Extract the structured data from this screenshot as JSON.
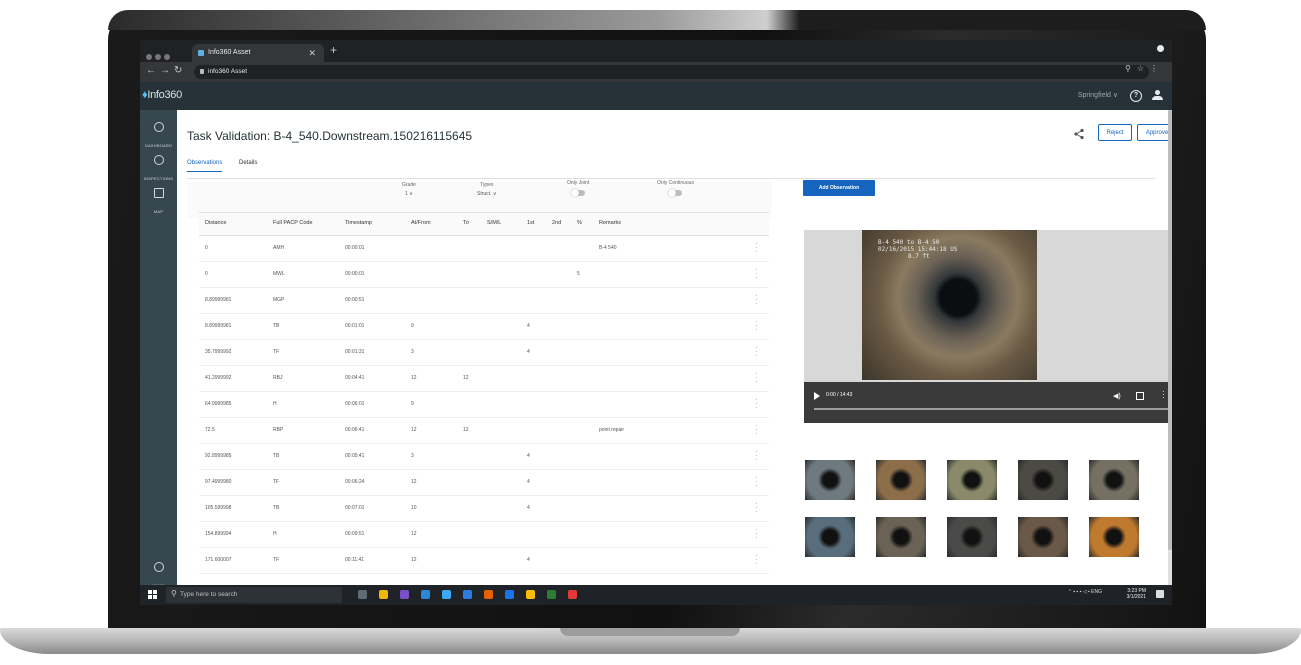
{
  "browser": {
    "tab_title": "Info360 Asset",
    "url": "info360 Asset"
  },
  "app": {
    "logo_text": "Info360",
    "user_location": "Springfield",
    "help_glyph": "?"
  },
  "sidebar": {
    "items": [
      {
        "label": "DASHBOARD",
        "icon": "dashboard-icon"
      },
      {
        "label": "INSPECTIONS",
        "icon": "inspections-icon"
      },
      {
        "label": "MAP",
        "icon": "map-icon"
      },
      {
        "label": "ADMIN",
        "icon": "settings-icon"
      }
    ]
  },
  "page": {
    "title": "Task Validation: B-4_540.Downstream.150216115645",
    "reject_label": "Reject",
    "approve_label": "Approve",
    "tabs": [
      "Observations",
      "Details"
    ]
  },
  "filters": {
    "grade_label": "Grade",
    "grade_value": "1 ∨",
    "types_label": "Types",
    "types_value": "Struct. ∨",
    "only_joint_label": "Only Joint",
    "only_continuous_label": "Only Continuous"
  },
  "table": {
    "columns": [
      "Distance",
      "Full PACP Code",
      "Timestamp",
      "At/From",
      "To",
      "S/M/L",
      "1st",
      "2nd",
      "%",
      "Remarks"
    ],
    "rows": [
      [
        "0",
        "AMH",
        "00:00:01",
        "",
        "",
        "",
        "",
        "",
        "",
        "B-4 540"
      ],
      [
        "0",
        "MWL",
        "00:00:01",
        "",
        "",
        "",
        "",
        "",
        "5",
        ""
      ],
      [
        "8.89999981",
        "MGP",
        "00:00:51",
        "",
        "",
        "",
        "",
        "",
        "",
        ""
      ],
      [
        "8.89999981",
        "TB",
        "00:01:01",
        "9",
        "",
        "",
        "4",
        "",
        "",
        ""
      ],
      [
        "35.7999992",
        "TF",
        "00:01:31",
        "3",
        "",
        "",
        "4",
        "",
        "",
        ""
      ],
      [
        "41.2999992",
        "RBJ",
        "00:04:41",
        "12",
        "12",
        "",
        "",
        "",
        "",
        ""
      ],
      [
        "64.9999985",
        "H",
        "00:06:01",
        "9",
        "",
        "",
        "",
        "",
        "",
        ""
      ],
      [
        "72.5",
        "RBP",
        "00:06:41",
        "12",
        "12",
        "",
        "",
        "",
        "",
        "point repair"
      ],
      [
        "92.8999985",
        "TB",
        "00:05:41",
        "3",
        "",
        "",
        "4",
        "",
        "",
        ""
      ],
      [
        "97.4999980",
        "TF",
        "00:06:24",
        "12",
        "",
        "",
        "4",
        "",
        "",
        ""
      ],
      [
        "105.599998",
        "TB",
        "00:07:01",
        "10",
        "",
        "",
        "4",
        "",
        "",
        ""
      ],
      [
        "154.899994",
        "H",
        "00:09:51",
        "12",
        "",
        "",
        "",
        "",
        "",
        ""
      ],
      [
        "171.600007",
        "TF",
        "00:11:41",
        "12",
        "",
        "",
        "4",
        "",
        "",
        ""
      ]
    ]
  },
  "right_panel": {
    "add_observation_label": "Add Observation",
    "video_overlay": [
      "B-4 540 to B-4 50",
      "02/16/2015 15:44:18 US",
      "8.7 ft"
    ],
    "video_time": "0:00 / 14:43",
    "thumb_colors": [
      "#6f7a80",
      "#8c6e4a",
      "#8a8a6a",
      "#4c4a44",
      "#767062",
      "#596e7c",
      "#6a6254",
      "#4a4a48",
      "#6a5848",
      "#c07a30"
    ]
  },
  "taskbar": {
    "search_placeholder": "Type here to search",
    "time": "3:23 PM",
    "date": "3/1/2021",
    "lang": "ENG",
    "app_icon_colors": [
      "#5f6b73",
      "#f2b705",
      "#7b4fc9",
      "#2b88d8",
      "#3da9f5",
      "#2d7de1",
      "#e66000",
      "#1a73e8",
      "#fbbc04",
      "#2e7d32",
      "#e53935"
    ]
  }
}
